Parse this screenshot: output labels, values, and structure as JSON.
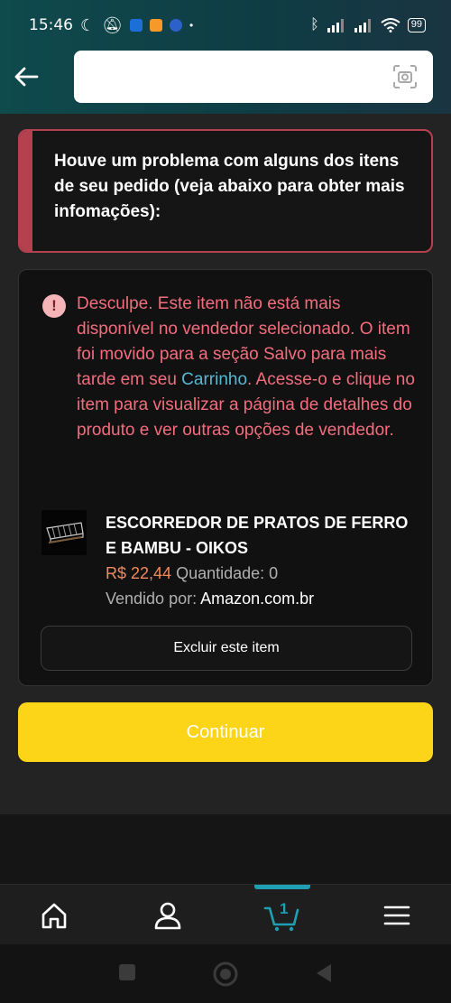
{
  "status_bar": {
    "time": "15:46",
    "battery": "99"
  },
  "header": {
    "search_placeholder": ""
  },
  "alert": {
    "message": "Houve um problema com alguns dos itens de seu pedido (veja abaixo para obter mais infomações):"
  },
  "item_error": {
    "text_before_link": "Desculpe. Este item não está mais disponível no vendedor selecionado. O item foi movido para a seção Salvo para mais tarde em seu ",
    "link": "Carrinho",
    "text_after_link": ". Acesse-o e clique no item para visualizar a página de detalhes do produto e ver outras opções de vendedor."
  },
  "product": {
    "title": "ESCORREDOR DE PRATOS DE FERRO E BAMBU - OIKOS",
    "price": "R$ 22,44",
    "quantity": "Quantidade: 0",
    "sold_by_label": "Vendido por:",
    "sold_by_value": "Amazon.com.br"
  },
  "buttons": {
    "delete_item": "Excluir este item",
    "continue": "Continuar"
  },
  "bottom_nav": {
    "cart_count": "1",
    "items": [
      "home-icon",
      "account-icon",
      "cart-icon",
      "menu-icon"
    ]
  },
  "colors": {
    "header_bg": "#0f4a4d",
    "alert_border": "#b5414f",
    "error_text": "#f26d7d",
    "link": "#57b8d4",
    "price": "#f08a5d",
    "continue_button": "#fcd418",
    "cart_accent": "#1e9fb3"
  }
}
